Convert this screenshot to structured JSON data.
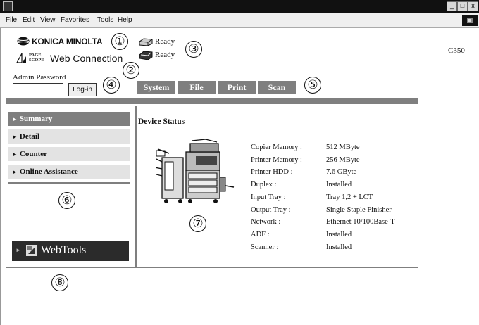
{
  "menu": {
    "items": [
      "File",
      "Edit",
      "View",
      "Favorites",
      "Tools",
      "Help"
    ]
  },
  "window_controls": {
    "minimize": "_",
    "restore": "□",
    "close": "x"
  },
  "header": {
    "brand": "KONICA MINOLTA",
    "pagescope_line1": "PAGE",
    "pagescope_line2": "SCOPE",
    "web_connection": "Web Connection",
    "model": "C350",
    "status_1": "Ready",
    "status_2": "Ready",
    "admin_password_label": "Admin Password",
    "login_button": "Log-in",
    "admin_password_value": ""
  },
  "tabs": [
    "System",
    "File",
    "Print",
    "Scan"
  ],
  "callouts": [
    "①",
    "②",
    "③",
    "④",
    "⑤",
    "⑥",
    "⑦",
    "⑧"
  ],
  "sidebar": {
    "items": [
      {
        "label": "Summary",
        "active": true
      },
      {
        "label": "Detail",
        "active": false
      },
      {
        "label": "Counter",
        "active": false
      },
      {
        "label": "Online Assistance",
        "active": false
      }
    ],
    "webtools_label": "WebTools"
  },
  "main": {
    "title": "Device Status",
    "rows": [
      {
        "label": "Copier Memory :",
        "value": "512 MByte"
      },
      {
        "label": "Printer Memory :",
        "value": "256 MByte"
      },
      {
        "label": "Printer HDD :",
        "value": "7.6 GByte"
      },
      {
        "label": "Duplex :",
        "value": "Installed"
      },
      {
        "label": "Input Tray :",
        "value": "Tray 1,2 + LCT"
      },
      {
        "label": "Output Tray :",
        "value": "Single Staple Finisher"
      },
      {
        "label": "Network :",
        "value": "Ethernet 10/100Base-T"
      },
      {
        "label": "ADF :",
        "value": "Installed"
      },
      {
        "label": "Scanner :",
        "value": "Installed"
      }
    ]
  },
  "colors": {
    "tab_gray": "#7f7f7f",
    "nav_light": "#e3e3e3",
    "webtools_bg": "#2b2b2b"
  }
}
